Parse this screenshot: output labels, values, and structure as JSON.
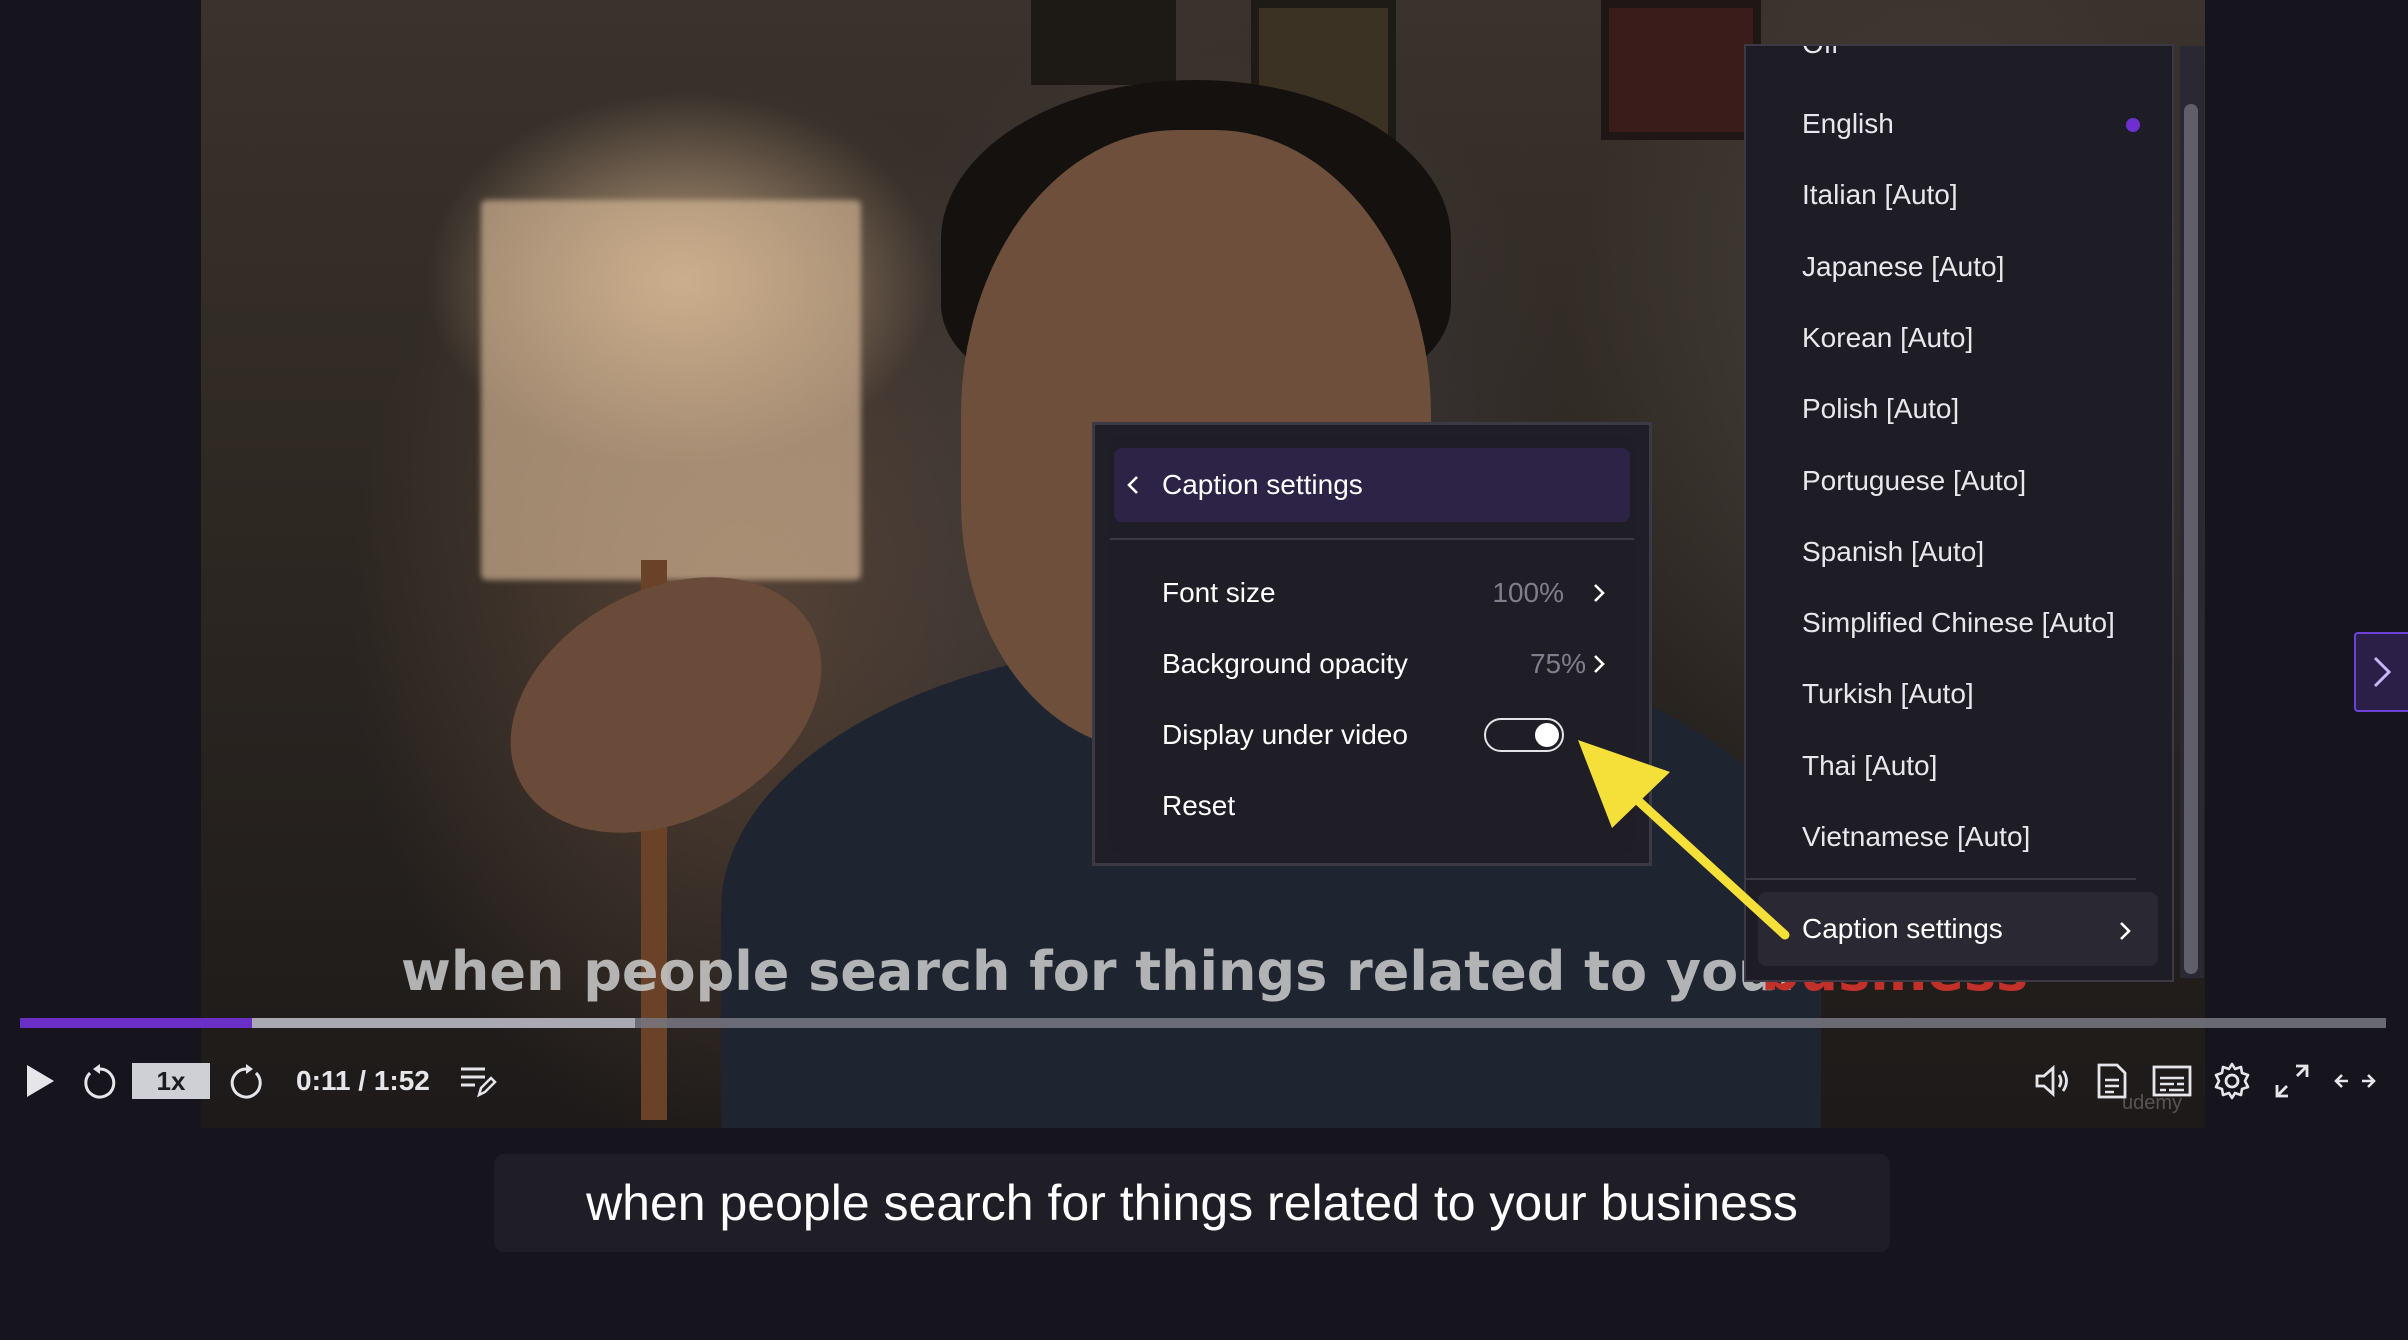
{
  "video": {
    "burned_caption": "when people search for things related to your",
    "burned_caption_red": "business",
    "progress": {
      "played_fraction": 0.098,
      "buffered_fraction": 0.26
    }
  },
  "controls": {
    "play_icon": "play-icon",
    "rewind_icon": "rewind-5-icon",
    "speed_label": "1x",
    "forward_icon": "forward-5-icon",
    "time_text": "0:11 / 1:52",
    "notes_icon": "add-note-icon",
    "volume_icon": "volume-icon",
    "transcript_icon": "transcript-icon",
    "captions_icon": "captions-icon",
    "settings_icon": "gear-icon",
    "fullscreen_icon": "fullscreen-icon",
    "expand_icon": "expand-width-icon",
    "watermark": "udemy"
  },
  "caption_display": {
    "text": "when people search for things related to your business"
  },
  "language_menu": {
    "partial_top_item": "Off",
    "items": [
      {
        "label": "English",
        "selected": true
      },
      {
        "label": "Italian [Auto]",
        "selected": false
      },
      {
        "label": "Japanese [Auto]",
        "selected": false
      },
      {
        "label": "Korean [Auto]",
        "selected": false
      },
      {
        "label": "Polish [Auto]",
        "selected": false
      },
      {
        "label": "Portuguese [Auto]",
        "selected": false
      },
      {
        "label": "Spanish [Auto]",
        "selected": false
      },
      {
        "label": "Simplified Chinese [Auto]",
        "selected": false
      },
      {
        "label": "Turkish [Auto]",
        "selected": false
      },
      {
        "label": "Thai [Auto]",
        "selected": false
      },
      {
        "label": "Vietnamese [Auto]",
        "selected": false
      }
    ],
    "caption_settings_label": "Caption settings"
  },
  "caption_settings_panel": {
    "title": "Caption settings",
    "font_size_label": "Font size",
    "font_size_value": "100%",
    "bg_opacity_label": "Background opacity",
    "bg_opacity_value": "75%",
    "display_under_label": "Display under video",
    "display_under_on": true,
    "reset_label": "Reset"
  },
  "colors": {
    "accent": "#6d2fd0",
    "annotation_arrow": "#f5e03a",
    "panel_bg": "#1f1e26"
  }
}
